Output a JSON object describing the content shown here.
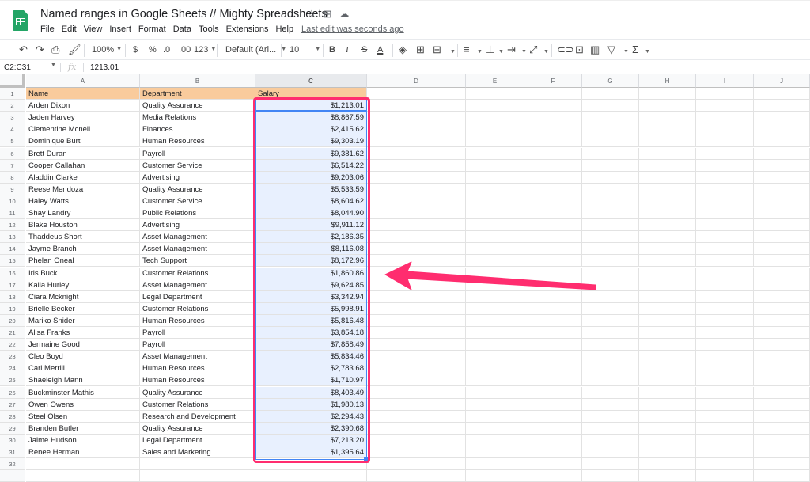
{
  "app": {
    "title": "Named ranges in Google Sheets // Mighty Spreadsheets",
    "menu": [
      "File",
      "Edit",
      "View",
      "Insert",
      "Format",
      "Data",
      "Tools",
      "Extensions",
      "Help"
    ],
    "last_edit": "Last edit was seconds ago",
    "title_icons": [
      "star-icon",
      "move-to-folder-icon",
      "cloud-status-icon"
    ]
  },
  "toolbar": {
    "zoom": "100%",
    "currency": "$",
    "percent": "%",
    "decrease_decimal": ".0",
    "increase_decimal": ".00",
    "more_formats": "123",
    "font": "Default (Ari...",
    "font_size": "10",
    "bold": "B",
    "italic": "I",
    "strikethrough": "S",
    "text_color": "A",
    "sum": "Σ"
  },
  "formula_bar": {
    "name_box": "C2:C31",
    "fx": "fx",
    "value": "1213.01"
  },
  "columns": [
    "A",
    "B",
    "C",
    "D",
    "E",
    "F",
    "G",
    "H",
    "I",
    "J"
  ],
  "selected_column": "C",
  "header_row": {
    "name": "Name",
    "department": "Department",
    "salary": "Salary"
  },
  "rows": [
    {
      "name": "Arden Dixon",
      "department": "Quality Assurance",
      "salary": "$1,213.01"
    },
    {
      "name": "Jaden Harvey",
      "department": "Media Relations",
      "salary": "$8,867.59"
    },
    {
      "name": "Clementine Mcneil",
      "department": "Finances",
      "salary": "$2,415.62"
    },
    {
      "name": "Dominique Burt",
      "department": "Human Resources",
      "salary": "$9,303.19"
    },
    {
      "name": "Brett Duran",
      "department": "Payroll",
      "salary": "$9,381.62"
    },
    {
      "name": "Cooper Callahan",
      "department": "Customer Service",
      "salary": "$6,514.22"
    },
    {
      "name": "Aladdin Clarke",
      "department": "Advertising",
      "salary": "$9,203.06"
    },
    {
      "name": "Reese Mendoza",
      "department": "Quality Assurance",
      "salary": "$5,533.59"
    },
    {
      "name": "Haley Watts",
      "department": "Customer Service",
      "salary": "$8,604.62"
    },
    {
      "name": "Shay Landry",
      "department": "Public Relations",
      "salary": "$8,044.90"
    },
    {
      "name": "Blake Houston",
      "department": "Advertising",
      "salary": "$9,911.12"
    },
    {
      "name": "Thaddeus Short",
      "department": "Asset Management",
      "salary": "$2,186.35"
    },
    {
      "name": "Jayme Branch",
      "department": "Asset Management",
      "salary": "$8,116.08"
    },
    {
      "name": "Phelan Oneal",
      "department": "Tech Support",
      "salary": "$8,172.96"
    },
    {
      "name": "Iris Buck",
      "department": "Customer Relations",
      "salary": "$1,860.86"
    },
    {
      "name": "Kalia Hurley",
      "department": "Asset Management",
      "salary": "$9,624.85"
    },
    {
      "name": "Ciara Mcknight",
      "department": "Legal Department",
      "salary": "$3,342.94"
    },
    {
      "name": "Brielle Becker",
      "department": "Customer Relations",
      "salary": "$5,998.91"
    },
    {
      "name": "Mariko Snider",
      "department": "Human Resources",
      "salary": "$5,816.48"
    },
    {
      "name": "Alisa Franks",
      "department": "Payroll",
      "salary": "$3,854.18"
    },
    {
      "name": "Jermaine Good",
      "department": "Payroll",
      "salary": "$7,858.49"
    },
    {
      "name": "Cleo Boyd",
      "department": "Asset Management",
      "salary": "$5,834.46"
    },
    {
      "name": "Carl Merrill",
      "department": "Human Resources",
      "salary": "$2,783.68"
    },
    {
      "name": "Shaeleigh Mann",
      "department": "Human Resources",
      "salary": "$1,710.97"
    },
    {
      "name": "Buckminster Mathis",
      "department": "Quality Assurance",
      "salary": "$8,403.49"
    },
    {
      "name": "Owen Owens",
      "department": "Customer Relations",
      "salary": "$1,980.13"
    },
    {
      "name": "Steel Olsen",
      "department": "Research and Development",
      "salary": "$2,294.43"
    },
    {
      "name": "Branden Butler",
      "department": "Quality Assurance",
      "salary": "$2,390.68"
    },
    {
      "name": "Jaime Hudson",
      "department": "Legal Department",
      "salary": "$7,213.20"
    },
    {
      "name": "Renee Herman",
      "department": "Sales and Marketing",
      "salary": "$1,395.64"
    }
  ],
  "visible_row_count": 32,
  "annotation": {
    "highlight_color": "#ff2d6f",
    "header_fill": "#f9cb9c",
    "selection_fill": "#e8f0fe"
  }
}
